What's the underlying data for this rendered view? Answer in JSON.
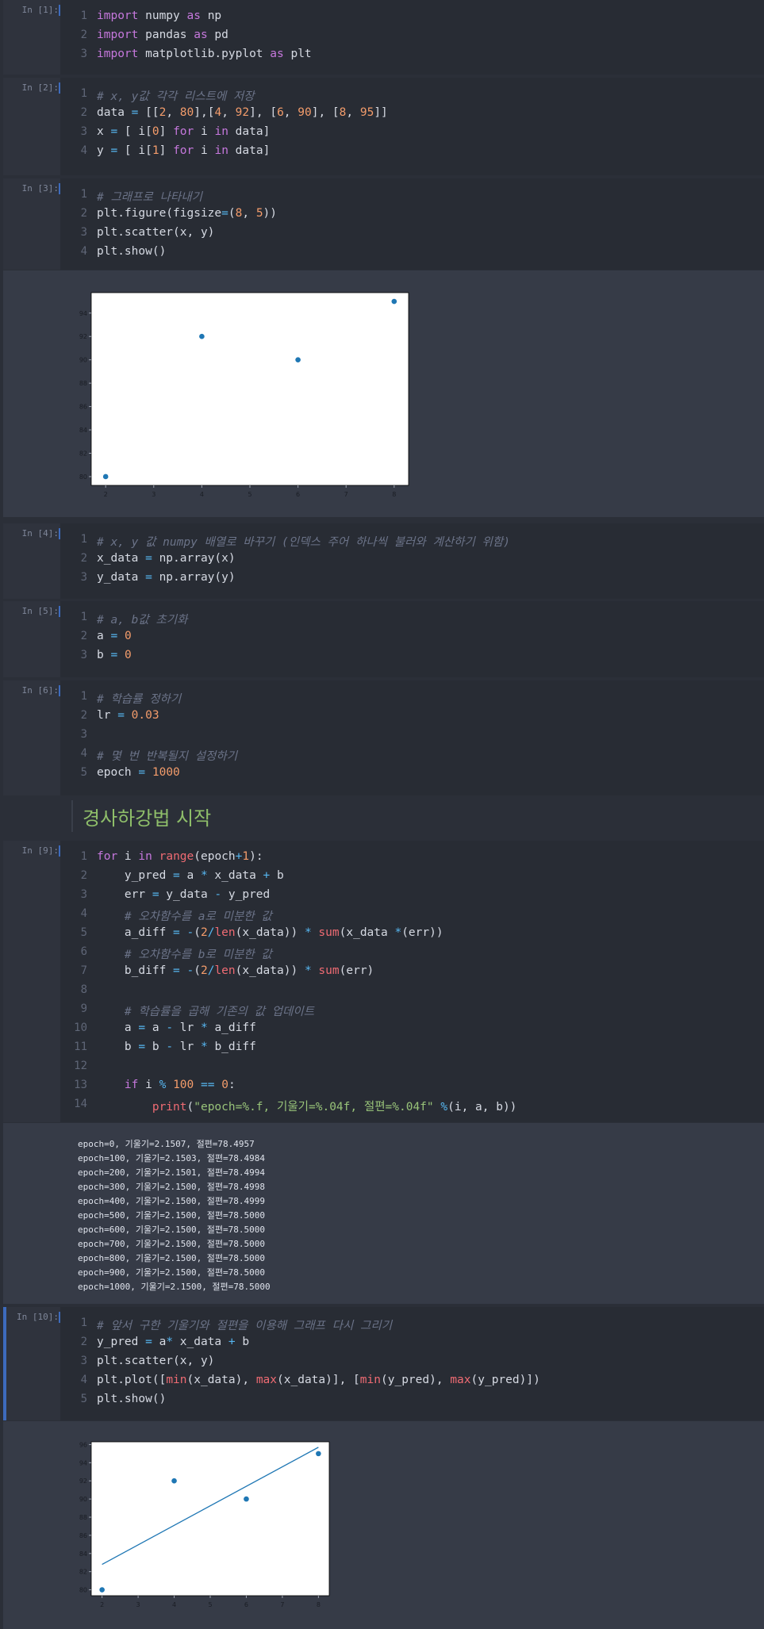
{
  "cells": [
    {
      "prompt": "In [1]:",
      "lines": [
        "import numpy as np",
        "import pandas as pd",
        "import matplotlib.pyplot as plt"
      ]
    },
    {
      "prompt": "In [2]:",
      "lines": [
        "# x, y값 각각 리스트에 저장",
        "data = [[2, 80],[4, 92], [6, 90], [8, 95]]",
        "x = [ i[0] for i in data]",
        "y = [ i[1] for i in data]"
      ]
    },
    {
      "prompt": "In [3]:",
      "lines": [
        "# 그래프로 나타내기",
        "plt.figure(figsize=(8, 5))",
        "plt.scatter(x, y)",
        "plt.show()"
      ]
    },
    {
      "prompt": "In [4]:",
      "lines": [
        "# x, y 값 numpy 배열로 바꾸기 (인덱스 주어 하나씩 불러와 계산하기 위함)",
        "x_data = np.array(x)",
        "y_data = np.array(y)"
      ]
    },
    {
      "prompt": "In [5]:",
      "lines": [
        "# a, b값 초기화",
        "a = 0",
        "b = 0"
      ]
    },
    {
      "prompt": "In [6]:",
      "lines": [
        "# 학습률 정하기",
        "lr = 0.03",
        "",
        "# 몇 번 반복될지 설정하기",
        "epoch = 1000"
      ]
    },
    {
      "prompt": "In [9]:",
      "lines": [
        "for i in range(epoch+1):",
        "    y_pred = a * x_data + b",
        "    err = y_data - y_pred",
        "    # 오차함수를 a로 미분한 값",
        "    a_diff = -(2/len(x_data)) * sum(x_data *(err))",
        "    # 오차함수를 b로 미분한 값",
        "    b_diff = -(2/len(x_data)) * sum(err)",
        "",
        "    # 학습률을 곱해 기존의 값 업데이트",
        "    a = a - lr * a_diff",
        "    b = b - lr * b_diff",
        "",
        "    if i % 100 == 0:",
        "        print(\"epoch=%.f, 기울기=%.04f, 절편=%.04f\" %(i, a, b))"
      ]
    },
    {
      "prompt": "In [10]:",
      "lines": [
        "# 앞서 구한 기울기와 절편을 이용해 그래프 다시 그리기",
        "y_pred = a* x_data + b",
        "plt.scatter(x, y)",
        "plt.plot([min(x_data), max(x_data)], [min(y_pred), max(y_pred)])",
        "plt.show()"
      ]
    }
  ],
  "markdown_heading": "경사하강법 시작",
  "stdout_lines": [
    "epoch=0, 기울기=2.1507, 절편=78.4957",
    "epoch=100, 기울기=2.1503, 절편=78.4984",
    "epoch=200, 기울기=2.1501, 절편=78.4994",
    "epoch=300, 기울기=2.1500, 절편=78.4998",
    "epoch=400, 기울기=2.1500, 절편=78.4999",
    "epoch=500, 기울기=2.1500, 절편=78.5000",
    "epoch=600, 기울기=2.1500, 절편=78.5000",
    "epoch=700, 기울기=2.1500, 절편=78.5000",
    "epoch=800, 기울기=2.1500, 절편=78.5000",
    "epoch=900, 기울기=2.1500, 절편=78.5000",
    "epoch=1000, 기울기=2.1500, 절편=78.5000"
  ],
  "colors": {
    "point": "#1f77b4",
    "line": "#1f77b4",
    "accent": "#3d6bbd"
  },
  "chart_data": [
    {
      "type": "scatter",
      "x": [
        2,
        4,
        6,
        8
      ],
      "y": [
        80,
        92,
        90,
        95
      ],
      "xticks": [
        2,
        3,
        4,
        5,
        6,
        7,
        8
      ],
      "yticks": [
        80,
        82,
        84,
        86,
        88,
        90,
        92,
        94
      ],
      "xlim": [
        1.7,
        8.3
      ],
      "ylim": [
        79.25,
        95.75
      ],
      "grid": false
    },
    {
      "type": "scatter",
      "x": [
        2,
        4,
        6,
        8
      ],
      "y": [
        80,
        92,
        90,
        95
      ],
      "line": {
        "x": [
          2,
          8
        ],
        "y": [
          82.8,
          95.7
        ]
      },
      "xticks": [
        2,
        3,
        4,
        5,
        6,
        7,
        8
      ],
      "yticks": [
        80,
        82,
        84,
        86,
        88,
        90,
        92,
        94,
        96
      ],
      "xlim": [
        1.7,
        8.3
      ],
      "ylim": [
        79.35,
        96.3
      ],
      "grid": false
    }
  ]
}
